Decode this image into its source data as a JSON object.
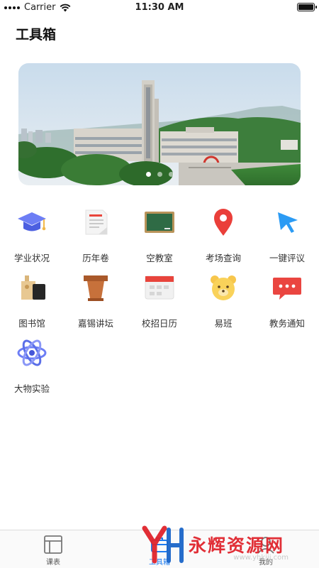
{
  "status": {
    "carrier": "Carrier",
    "time": "11:30 AM",
    "battery_level": 1.0
  },
  "page": {
    "title": "工具箱"
  },
  "banner": {
    "slides": 3,
    "active_slide": 0
  },
  "tools": [
    {
      "label": "学业状况",
      "icon": "graduation-cap-icon"
    },
    {
      "label": "历年卷",
      "icon": "document-icon"
    },
    {
      "label": "空教室",
      "icon": "blackboard-icon"
    },
    {
      "label": "考场查询",
      "icon": "location-pin-icon"
    },
    {
      "label": "一键评议",
      "icon": "cursor-arrow-icon"
    },
    {
      "label": "图书馆",
      "icon": "library-books-icon"
    },
    {
      "label": "嘉锡讲坛",
      "icon": "podium-icon"
    },
    {
      "label": "校招日历",
      "icon": "calendar-icon"
    },
    {
      "label": "易班",
      "icon": "bear-icon"
    },
    {
      "label": "教务通知",
      "icon": "message-icon"
    },
    {
      "label": "大物实验",
      "icon": "atom-icon"
    }
  ],
  "tabbar": {
    "tabs": [
      {
        "label": "课表",
        "icon": "timetable-icon",
        "active": false
      },
      {
        "label": "工具箱",
        "icon": "toolbox-icon",
        "active": true
      },
      {
        "label": "我的",
        "icon": "profile-icon",
        "active": false
      }
    ]
  },
  "watermark": {
    "text": "永辉资源网",
    "url": "www.yhkjjj.com"
  },
  "colors": {
    "accent": "#1e7cf0",
    "watermark": "#e0242c"
  }
}
